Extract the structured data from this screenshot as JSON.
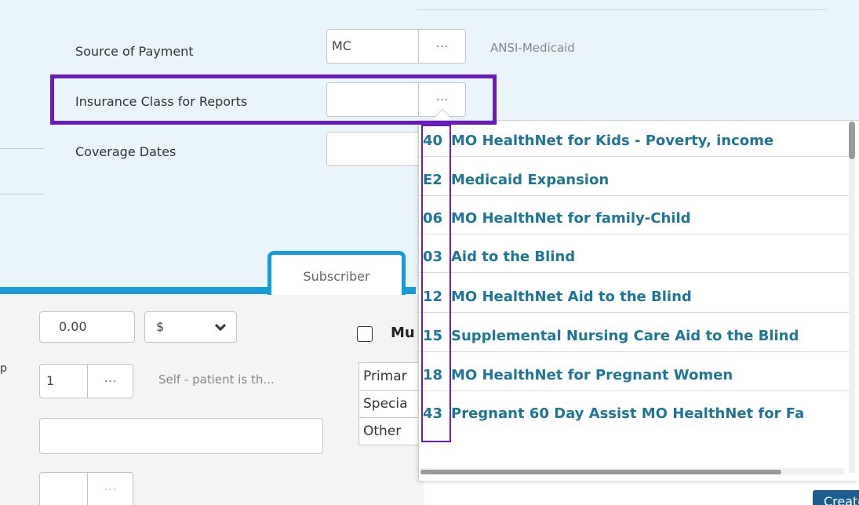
{
  "form": {
    "source_of_payment": {
      "label": "Source of Payment",
      "value": "MC",
      "button": "...",
      "description": "ANSI-Medicaid"
    },
    "insurance_class": {
      "label": "Insurance Class for Reports",
      "value": "",
      "button": "..."
    },
    "coverage_dates": {
      "label": "Coverage Dates",
      "value": ""
    }
  },
  "tabs": {
    "subscriber": "Subscriber"
  },
  "subscriber": {
    "amount": {
      "value": "0.00"
    },
    "currency": {
      "selected": "$",
      "icon": "chevron-down-icon"
    },
    "relationship_prefix": "p",
    "relationship": {
      "value": "1",
      "button": "...",
      "description": "Self - patient is th..."
    },
    "name_value": "",
    "extra_button": "...",
    "multi_checkbox_label": "Mu",
    "list_items": [
      "Primar",
      "Specia",
      "Other"
    ]
  },
  "dropdown": {
    "items": [
      {
        "code": "40",
        "label": "MO HealthNet for Kids - Poverty, income"
      },
      {
        "code": "E2",
        "label": "Medicaid Expansion"
      },
      {
        "code": "06",
        "label": "MO HealthNet for family-Child"
      },
      {
        "code": "03",
        "label": "Aid to the Blind"
      },
      {
        "code": "12",
        "label": "MO HealthNet Aid to the Blind"
      },
      {
        "code": "15",
        "label": "Supplemental Nursing Care Aid to the Blind"
      },
      {
        "code": "18",
        "label": "MO HealthNet for Pregnant Women"
      },
      {
        "code": "43",
        "label": "Pregnant 60 Day Assist MO HealthNet for Fa"
      }
    ]
  },
  "actions": {
    "create_new": "Create New"
  },
  "colors": {
    "accent": "#1a9ad6",
    "highlight": "#6a1bbf",
    "link": "#1f7595",
    "panel": "#eaf5fb",
    "button": "#1b5c91"
  }
}
